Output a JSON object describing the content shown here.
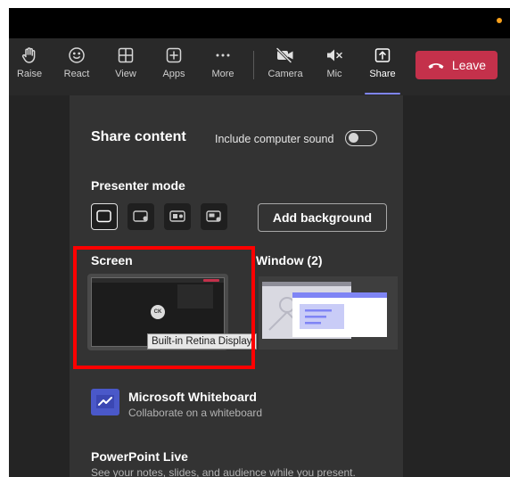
{
  "toolbar": {
    "raise": "Raise",
    "react": "React",
    "view": "View",
    "apps": "Apps",
    "more": "More",
    "camera": "Camera",
    "mic": "Mic",
    "share": "Share",
    "leave": "Leave"
  },
  "share_panel": {
    "title": "Share content",
    "include_sound_label": "Include computer sound",
    "include_sound_on": false,
    "presenter_mode_heading": "Presenter mode",
    "add_background_label": "Add background",
    "screen_heading": "Screen",
    "window_heading": "Window (2)",
    "screen_tooltip": "Built-in Retina Display",
    "avatar_initials": "CK",
    "whiteboard_title": "Microsoft Whiteboard",
    "whiteboard_sub": "Collaborate on a whiteboard",
    "powerpoint_title": "PowerPoint Live",
    "powerpoint_sub": "See your notes, slides, and audience while you present."
  },
  "icons": {
    "raise": "hand-icon",
    "react": "smiley-icon",
    "view": "grid-icon",
    "apps": "plus-square-icon",
    "more": "ellipsis-icon",
    "camera": "camera-off-icon",
    "mic": "mic-muted-icon",
    "share": "share-tray-icon",
    "leave": "hangup-phone-icon"
  },
  "colors": {
    "leave_button": "#c4314b",
    "accent": "#7f85f5",
    "highlight_box": "#ff0000",
    "whiteboard_brand": "#4a58c9",
    "status_dot": "#f7a01c"
  }
}
